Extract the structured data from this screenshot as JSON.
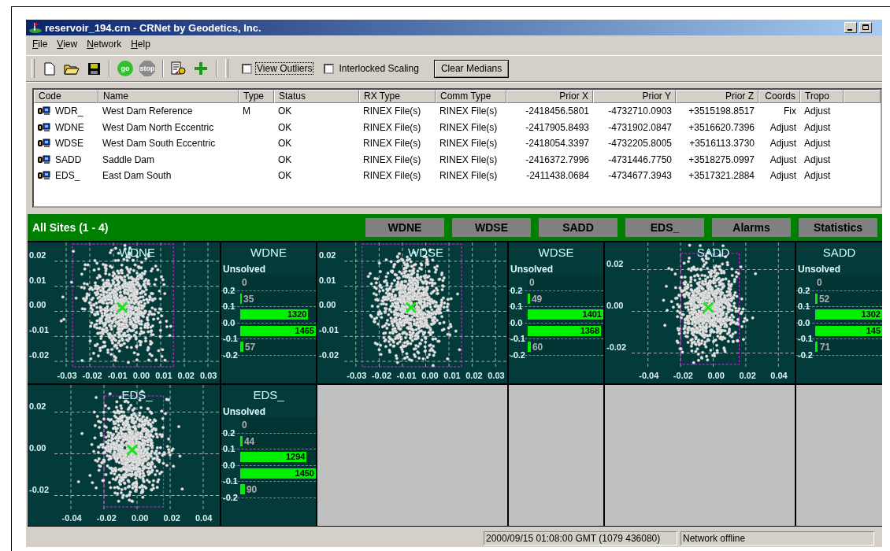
{
  "window": {
    "title": "reservoir_194.crn - CRNet by Geodetics, Inc."
  },
  "menu": [
    "File",
    "View",
    "Network",
    "Help"
  ],
  "toolbar": {
    "groups": [
      [
        {
          "kind": "new"
        },
        {
          "kind": "open"
        },
        {
          "kind": "save"
        }
      ],
      [
        {
          "kind": "go",
          "label": "go"
        },
        {
          "kind": "stop",
          "label": "stop"
        }
      ],
      [
        {
          "kind": "wizard"
        },
        {
          "kind": "add"
        }
      ]
    ],
    "checkboxes": [
      {
        "label": "View Outliers",
        "checked": false,
        "focused": true
      },
      {
        "label": "Interlocked Scaling",
        "checked": false,
        "focused": false
      }
    ],
    "action_button": "Clear Medians"
  },
  "sites_table": {
    "columns": [
      "Code",
      "Name",
      "Type",
      "Status",
      "RX Type",
      "Comm Type",
      "Prior X",
      "Prior Y",
      "Prior Z",
      "Coords",
      "Tropo"
    ],
    "rows": [
      [
        "WDR_",
        "West Dam Reference",
        "M",
        "OK",
        "RINEX File(s)",
        "RINEX File(s)",
        "-2418456.5801",
        "-4732710.0903",
        "+3515198.8517",
        "Fix",
        "Adjust"
      ],
      [
        "WDNE",
        "West Dam North Eccentric",
        "",
        "OK",
        "RINEX File(s)",
        "RINEX File(s)",
        "-2417905.8493",
        "-4731902.0847",
        "+3516620.7396",
        "Adjust",
        "Adjust"
      ],
      [
        "WDSE",
        "West Dam South Eccentric",
        "",
        "OK",
        "RINEX File(s)",
        "RINEX File(s)",
        "-2418054.3397",
        "-4732205.8005",
        "+3516113.3730",
        "Adjust",
        "Adjust"
      ],
      [
        "SADD",
        "Saddle Dam",
        "",
        "OK",
        "RINEX File(s)",
        "RINEX File(s)",
        "-2416372.7996",
        "-4731446.7750",
        "+3518275.0997",
        "Adjust",
        "Adjust"
      ],
      [
        "EDS_",
        "East Dam South",
        "",
        "OK",
        "RINEX File(s)",
        "RINEX File(s)",
        "-2411438.0684",
        "-4734677.3943",
        "+3517321.2884",
        "Adjust",
        "Adjust"
      ]
    ]
  },
  "monitor": {
    "title": "All Sites (1 - 4)",
    "buttons": [
      "WDNE",
      "WDSE",
      "SADD",
      "EDS_",
      "Alarms",
      "Statistics"
    ],
    "panel_rows": [
      [
        {
          "kind": "scatter",
          "title": "WDNE",
          "y_ticks": [
            "0.02",
            "0.01",
            "0.00",
            "-0.01",
            "-0.02"
          ],
          "x_ticks": [
            "-0.03",
            "-0.02",
            "-0.01",
            "0.00",
            "0.01",
            "0.02",
            "0.03"
          ]
        },
        {
          "kind": "histogram",
          "title": "WDNE",
          "unsolved_label": "Unsolved",
          "ticks": [
            "0.2",
            "0.1",
            "0.0",
            "-0.1",
            "-0.2"
          ],
          "bars": [
            {
              "count": "0"
            },
            {
              "count": "35",
              "level": 0.02
            },
            {
              "count": "1320",
              "level": 0.9
            },
            {
              "count": "1465",
              "level": 1
            },
            {
              "count": "57",
              "level": 0.04
            }
          ]
        },
        {
          "kind": "scatter",
          "title": "WDSE",
          "y_ticks": [
            "0.02",
            "0.01",
            "0.00",
            "-0.01",
            "-0.02"
          ],
          "x_ticks": [
            "-0.03",
            "-0.02",
            "-0.01",
            "0.00",
            "0.01",
            "0.02",
            "0.03"
          ]
        },
        {
          "kind": "histogram",
          "title": "WDSE",
          "unsolved_label": "Unsolved",
          "ticks": [
            "0.2",
            "0.1",
            "0.0",
            "-0.1",
            "-0.2"
          ],
          "bars": [
            {
              "count": "0"
            },
            {
              "count": "49",
              "level": 0.03
            },
            {
              "count": "1401",
              "level": 1
            },
            {
              "count": "1368",
              "level": 0.97
            },
            {
              "count": "60",
              "level": 0.04
            }
          ]
        },
        {
          "kind": "scatter",
          "title": "SADD",
          "y_ticks": [
            "0.02",
            "0.00",
            "-0.02"
          ],
          "x_ticks": [
            "-0.04",
            "-0.02",
            "0.00",
            "0.02",
            "0.04"
          ]
        },
        {
          "kind": "histogram",
          "title": "SADD",
          "unsolved_label": "Unsolved",
          "ticks": [
            "0.2",
            "0.1",
            "0.0",
            "-0.1",
            "-0.2"
          ],
          "bars": [
            {
              "count": "0"
            },
            {
              "count": "52",
              "level": 0.03
            },
            {
              "count": "1302",
              "level": 1
            },
            {
              "count": "145",
              "level": 1
            },
            {
              "count": "71",
              "level": 0.04
            }
          ]
        }
      ],
      [
        {
          "kind": "scatter",
          "title": "EDS_",
          "y_ticks": [
            "0.02",
            "0.00",
            "-0.02"
          ],
          "x_ticks": [
            "-0.04",
            "-0.02",
            "0.00",
            "0.02",
            "0.04"
          ]
        },
        {
          "kind": "histogram",
          "title": "EDS_",
          "unsolved_label": "Unsolved",
          "ticks": [
            "0.2",
            "0.1",
            "0.0",
            "-0.1",
            "-0.2"
          ],
          "bars": [
            {
              "count": "0"
            },
            {
              "count": "44",
              "level": 0.03
            },
            {
              "count": "1294",
              "level": 0.88
            },
            {
              "count": "1450",
              "level": 1
            },
            {
              "count": "90",
              "level": 0.06
            }
          ]
        },
        {
          "kind": "empty"
        },
        {
          "kind": "empty"
        },
        {
          "kind": "empty"
        },
        {
          "kind": "empty"
        }
      ]
    ]
  },
  "status_bar": [
    "2000/09/15 01:08:00 GMT (1079 436080)",
    "Network offline"
  ]
}
